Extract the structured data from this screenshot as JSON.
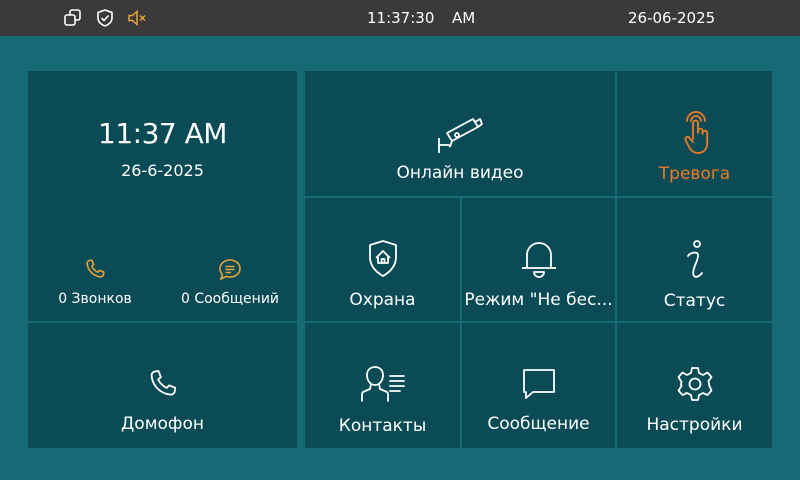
{
  "statusbar": {
    "icons": [
      "copy-icon",
      "shield-check-icon",
      "speaker-muted-icon"
    ],
    "time": "11:37:30",
    "ampm": "AM",
    "date": "26-06-2025"
  },
  "clock_panel": {
    "time": "11:37 AM",
    "date": "26-6-2025",
    "calls_label": "0 Звонков",
    "messages_label": "0 Сообщений"
  },
  "tiles": {
    "intercom": "Домофон",
    "online_video": "Онлайн видео",
    "alarm": "Тревога",
    "security": "Охрана",
    "dnd_mode": "Режим \"Не бес...",
    "status": "Статус",
    "contacts": "Контакты",
    "message": "Сообщение",
    "settings": "Настройки"
  },
  "colors": {
    "background": "#156a76",
    "tile": "#0a4b55",
    "statusbar": "#3a3a3a",
    "accent_orange": "#f07a25",
    "icon_yellow": "#e8a33a",
    "text": "#ffffff"
  }
}
